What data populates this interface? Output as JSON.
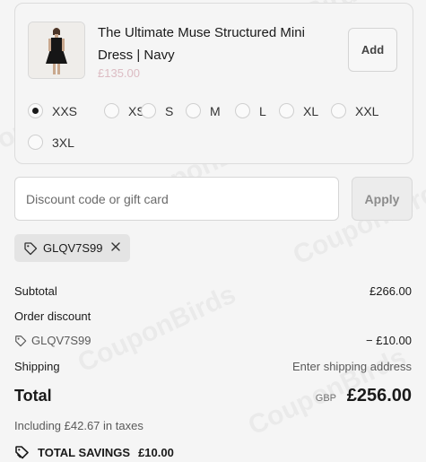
{
  "watermark": "CouponBirds",
  "product": {
    "title": "The Ultimate Muse Structured Mini Dress | Navy",
    "price": "£135.00",
    "add_label": "Add",
    "image_icon": "dress-product-image"
  },
  "sizes": [
    {
      "label": "XXS",
      "selected": true
    },
    {
      "label": "XS",
      "selected": false
    },
    {
      "label": "S",
      "selected": false
    },
    {
      "label": "M",
      "selected": false
    },
    {
      "label": "L",
      "selected": false
    },
    {
      "label": "XL",
      "selected": false
    },
    {
      "label": "XXL",
      "selected": false
    },
    {
      "label": "3XL",
      "selected": false
    }
  ],
  "discount": {
    "placeholder": "Discount code or gift card",
    "value": "",
    "apply_label": "Apply",
    "applied_code": "GLQV7S99"
  },
  "summary": {
    "subtotal_label": "Subtotal",
    "subtotal_value": "£266.00",
    "order_discount_label": "Order discount",
    "discount_code": "GLQV7S99",
    "discount_value": "− £10.00",
    "shipping_label": "Shipping",
    "shipping_value": "Enter shipping address",
    "total_label": "Total",
    "currency": "GBP",
    "total_value": "£256.00",
    "taxes_note": "Including £42.67 in taxes",
    "savings_label": "TOTAL SAVINGS",
    "savings_value": "£10.00"
  },
  "colors": {
    "background": "#f5f5f5",
    "price": "#dcbcc3",
    "text": "#1a1a1a"
  }
}
